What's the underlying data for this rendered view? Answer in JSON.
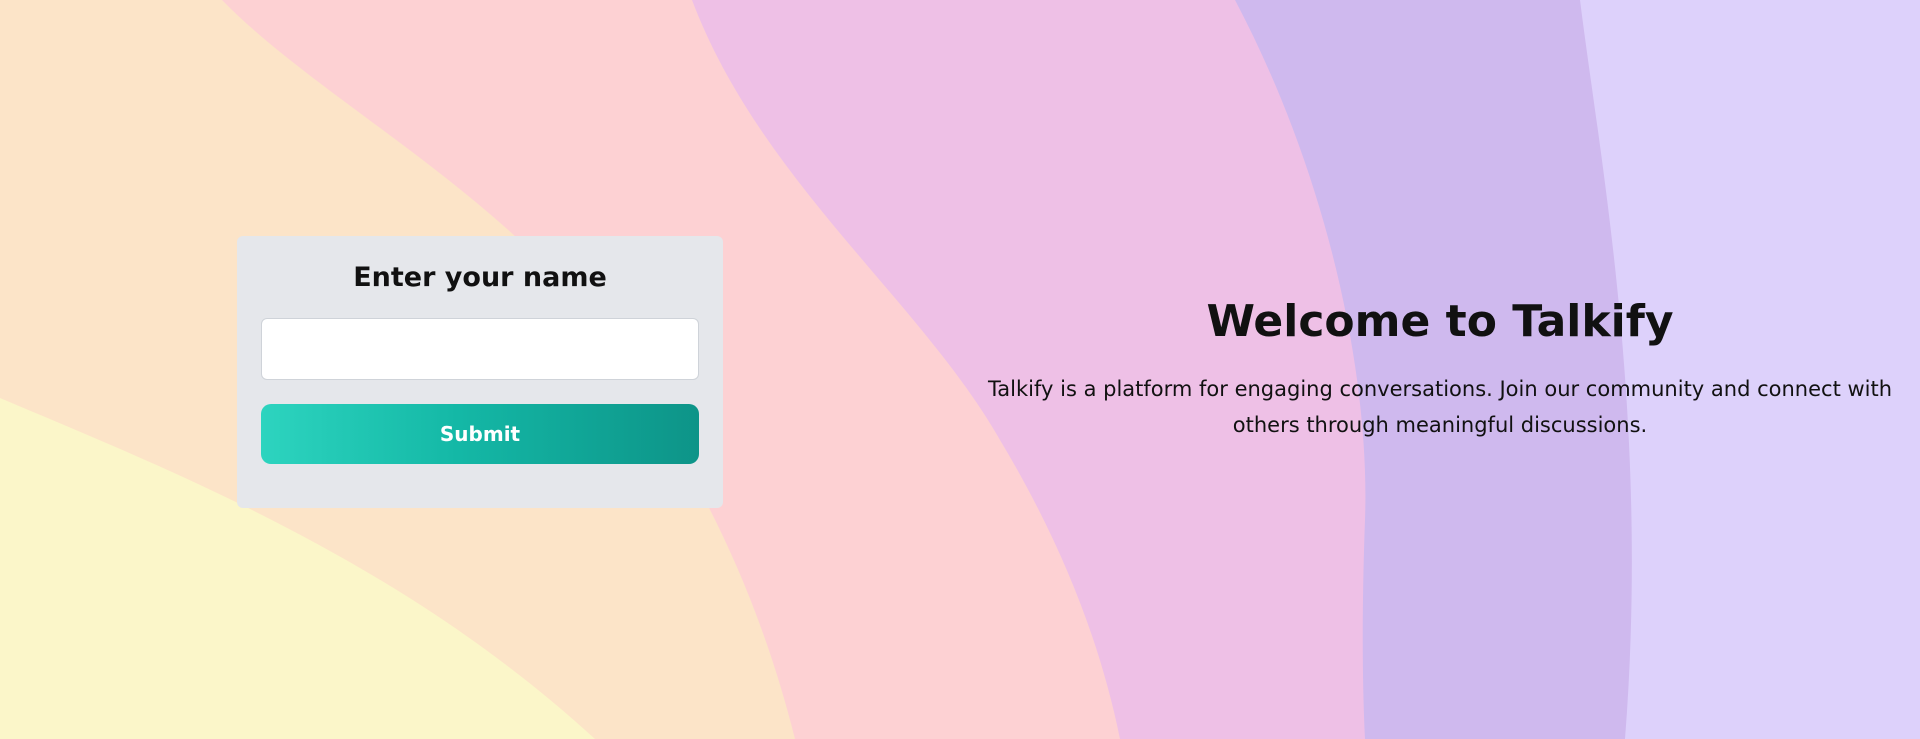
{
  "colors": {
    "background_bands": [
      "#fbf6c9",
      "#fce4c8",
      "#fdd1d3",
      "#eec0e6",
      "#cfb9ee",
      "#ddd1fb"
    ],
    "card_background": "#e5e7eb",
    "button_gradient": [
      "#2dd4bf",
      "#0d9488"
    ],
    "text": "#111111"
  },
  "login_card": {
    "title": "Enter your name",
    "name_input": {
      "value": "",
      "placeholder": ""
    },
    "submit_label": "Submit"
  },
  "hero": {
    "title": "Welcome to Talkify",
    "description": "Talkify is a platform for engaging conversations. Join our community and connect with others through meaningful discussions."
  }
}
